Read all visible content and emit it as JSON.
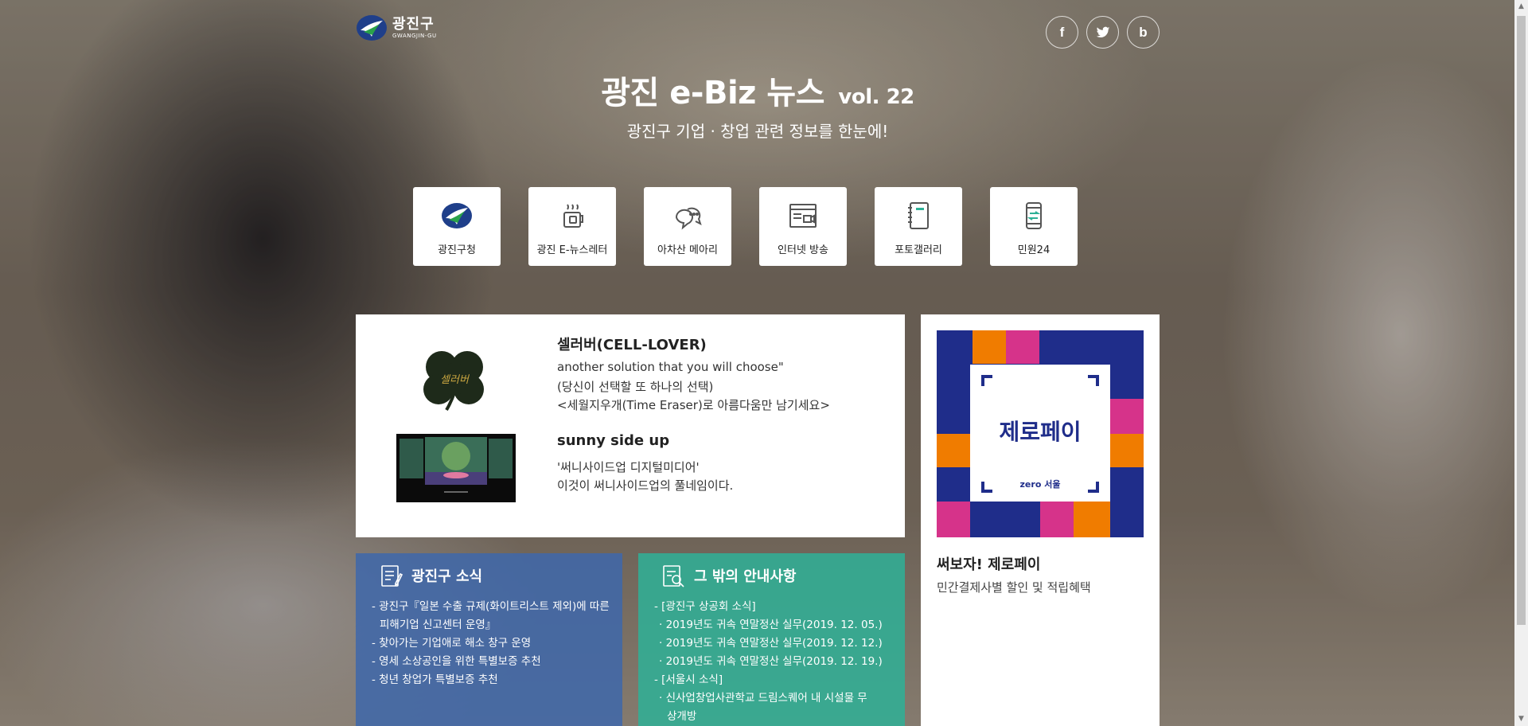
{
  "header": {
    "logo_ko": "광진구",
    "logo_en": "GWANGJIN-GU",
    "title": "광진 e-Biz 뉴스",
    "volume": "vol. 22",
    "subtitle": "광진구 기업 · 창업 관련 정보를 한눈에!",
    "sns": [
      {
        "icon": "facebook-icon",
        "glyph": "f"
      },
      {
        "icon": "twitter-icon",
        "glyph": "t"
      },
      {
        "icon": "band-icon",
        "glyph": "b"
      }
    ]
  },
  "quick_menu": [
    {
      "label": "광진구청",
      "icon": "gwangjin-logo-icon"
    },
    {
      "label": "광진 E-뉴스레터",
      "icon": "coffee-icon"
    },
    {
      "label": "아차산 메아리",
      "icon": "speech-bubble-icon"
    },
    {
      "label": "인터넷 방송",
      "icon": "video-window-icon"
    },
    {
      "label": "포토갤러리",
      "icon": "notebook-icon"
    },
    {
      "label": "민원24",
      "icon": "mobile-icon"
    }
  ],
  "featured": {
    "item1": {
      "title": "셀러버(CELL-LOVER)",
      "lines": [
        "another solution that you will choose\"",
        "(당신이 선택할 또 하나의 선택)",
        "<세월지우개(Time Eraser)로 아름다움만 남기세요>"
      ],
      "logo_text": "셀러버"
    },
    "item2": {
      "title": "sunny side up",
      "lines": [
        "'써니사이드업 디지털미디어'",
        "이것이 써니사이드업의 풀네임이다."
      ]
    }
  },
  "side": {
    "banner_text": "제로페이",
    "banner_sub": "zero 서울",
    "title": "써보자! 제로페이",
    "desc": "민간결제사별 할인 및 적립혜택"
  },
  "news_box": {
    "title": "광진구 소식",
    "items": [
      "- 광진구『일본 수출 규제(화이트리스트 제외)에 따른",
      "   피해기업 신고센터 운영』",
      "- 찾아가는 기업애로 해소 창구 운영",
      "- 영세 소상공인을 위한 특별보증 추천",
      "- 청년 창업가 특별보증 추천"
    ]
  },
  "info_box": {
    "title": "그 밖의 안내사항",
    "items": [
      "- [광진구 상공회 소식]",
      "  · 2019년도 귀속 연말정산 실무(2019. 12. 05.)",
      "  · 2019년도 귀속 연말정산 실무(2019. 12. 12.)",
      "  · 2019년도 귀속 연말정산 실무(2019. 12. 19.)",
      "- [서울시 소식]",
      "  · 신사업창업사관학교 드림스퀘어 내 시설물 무",
      "    상개방"
    ]
  },
  "colors": {
    "news_blue": "#3f68aa",
    "info_green": "#2fb096",
    "zero_navy": "#1f2d8a",
    "zero_orange": "#f07c00",
    "zero_pink": "#d6338a"
  }
}
